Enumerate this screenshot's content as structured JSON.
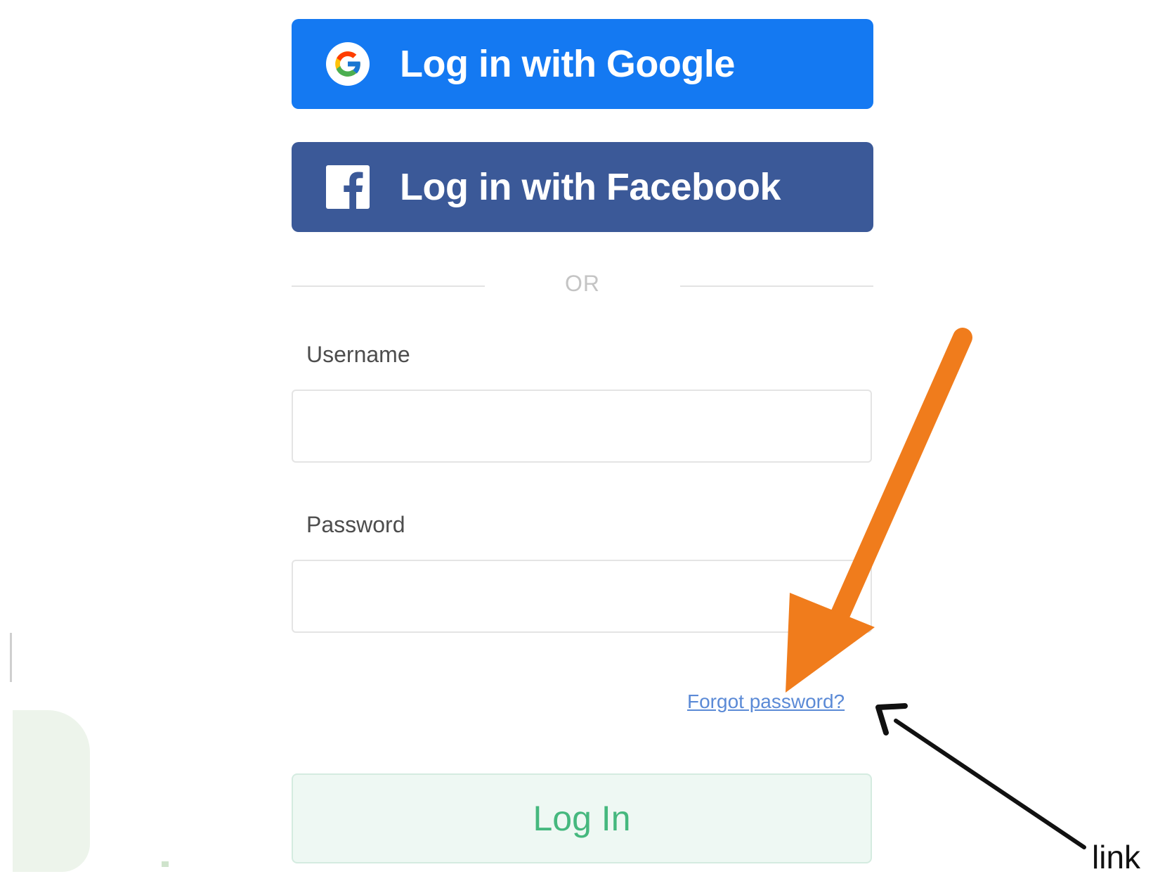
{
  "login": {
    "google_button_label": "Log in with Google",
    "facebook_button_label": "Log in with Facebook",
    "divider_text": "OR",
    "username_label": "Username",
    "username_value": "",
    "password_label": "Password",
    "password_value": "",
    "forgot_password_link": "Forgot password?",
    "login_button_label": "Log In"
  },
  "annotation": {
    "label": "link"
  },
  "icons": {
    "google": "google-icon",
    "facebook": "facebook-icon",
    "orange_arrow": "arrow-icon",
    "black_arrow": "arrow-icon"
  },
  "colors": {
    "google_blue": "#1479f2",
    "facebook_blue": "#3b5998",
    "login_green": "#45b87e",
    "login_bg": "#eef8f3",
    "link_blue": "#5b8ad6",
    "arrow_orange": "#f07c1c",
    "arrow_black": "#111111"
  }
}
